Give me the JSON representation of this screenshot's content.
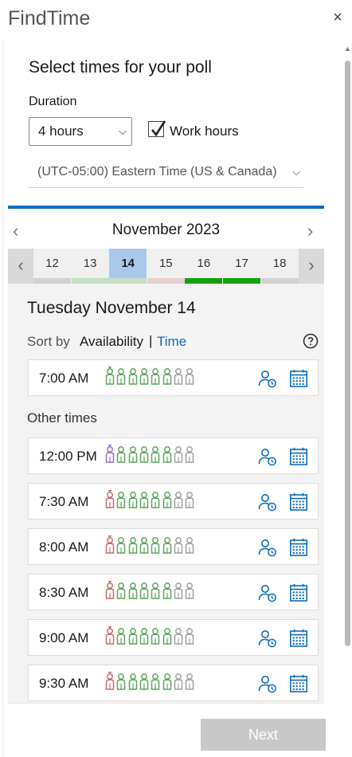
{
  "app": {
    "title": "FindTime",
    "close_symbol": "×"
  },
  "setup": {
    "heading": "Select times for your poll",
    "duration_label": "Duration",
    "duration_value": "4 hours",
    "work_hours_label": "Work hours",
    "work_hours_checked": true,
    "timezone_value": "(UTC-05:00) Eastern Time (US & Canada)"
  },
  "calendar": {
    "month": "November 2023",
    "days": [
      {
        "label": "12",
        "bar_color": "#d2d2d2",
        "selected": false
      },
      {
        "label": "13",
        "bar_color": "#c6dfc6",
        "selected": false
      },
      {
        "label": "14",
        "bar_color": "#c6dfc6",
        "selected": true
      },
      {
        "label": "15",
        "bar_color": "#e6cfcf",
        "selected": false
      },
      {
        "label": "16",
        "bar_color": "#13a10e",
        "selected": false
      },
      {
        "label": "17",
        "bar_color": "#13a10e",
        "selected": false
      },
      {
        "label": "18",
        "bar_color": "#d2d2d2",
        "selected": false
      }
    ]
  },
  "results": {
    "date_heading": "Tuesday November 14",
    "sort_by_label": "Sort by",
    "sort_availability": "Availability",
    "sort_separator": "|",
    "sort_time": "Time",
    "other_times_label": "Other times",
    "colors": {
      "free": "#5ca65c",
      "organizer_free": "#5ca65c",
      "organizer_tentative": "#8f6fc2",
      "organizer_busy": "#c96a6a",
      "unknown": "#a0a0a0",
      "accent": "#0f6cbd"
    },
    "top_slot": {
      "time": "7:00 AM",
      "organizer": "free"
    },
    "other_slots": [
      {
        "time": "12:00 PM",
        "organizer": "tentative"
      },
      {
        "time": "7:30 AM",
        "organizer": "busy"
      },
      {
        "time": "8:00 AM",
        "organizer": "busy"
      },
      {
        "time": "8:30 AM",
        "organizer": "busy"
      },
      {
        "time": "9:00 AM",
        "organizer": "busy"
      },
      {
        "time": "9:30 AM",
        "organizer": "busy"
      }
    ],
    "attendee_counts": {
      "free_others": 5,
      "unknown": 2
    }
  },
  "footer": {
    "next_label": "Next"
  }
}
